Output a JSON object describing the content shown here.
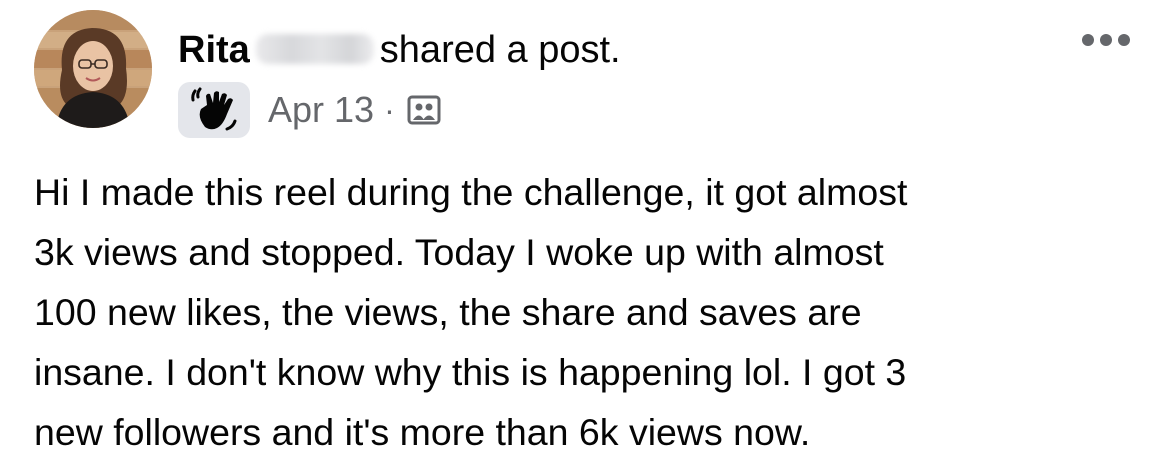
{
  "post": {
    "author": {
      "name": "Rita",
      "action_text": "shared a post."
    },
    "meta": {
      "badge_icon": "waving-hand-icon",
      "date": "Apr 13",
      "separator": "·",
      "audience_icon": "group-audience-icon"
    },
    "more_icon": "more-options-icon",
    "body": {
      "line1": "Hi I made this reel during the challenge, it got almost",
      "line2": "3k views and stopped. Today I woke up with almost",
      "line3_highlighted": "100 new likes, the views, the share and saves are",
      "line4_highlighted": "insane",
      "line4_rest": ". I don't know why this is happening lol. I got 3",
      "line5": "new followers and it's more than 6k views now."
    },
    "colors": {
      "highlight": "#c8f07a",
      "text": "#050505",
      "secondary_text": "#65676b",
      "badge_bg": "#e4e6eb"
    }
  }
}
